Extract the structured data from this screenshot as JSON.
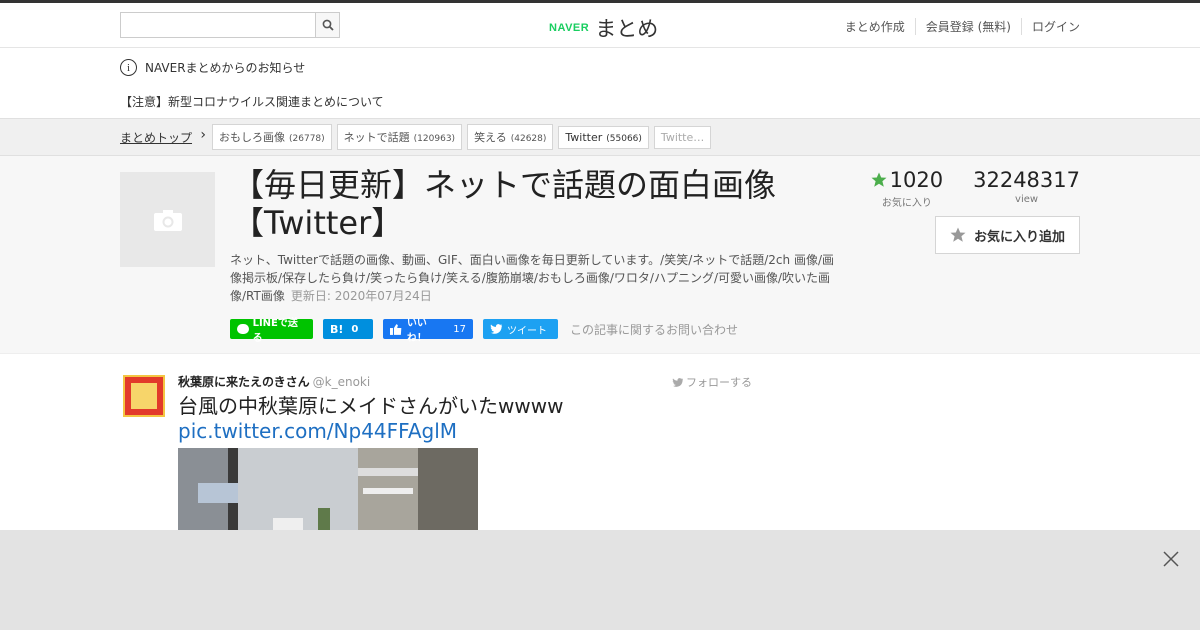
{
  "header": {
    "search_placeholder": "",
    "logo_brand": "NAVER",
    "logo_text": "まとめ",
    "links": [
      "まとめ作成",
      "会員登録 (無料)",
      "ログイン"
    ]
  },
  "notice": {
    "title": "NAVERまとめからのお知らせ",
    "item": "【注意】新型コロナウイルス関連まとめについて"
  },
  "breadcrumb": {
    "top": "まとめトップ",
    "tags": [
      {
        "label": "おもしろ画像",
        "count": "(26778)"
      },
      {
        "label": "ネットで話題",
        "count": "(120963)"
      },
      {
        "label": "笑える",
        "count": "(42628)"
      },
      {
        "label": "Twitter",
        "count": "(55066)"
      },
      {
        "label": "Twitte…",
        "count": ""
      }
    ]
  },
  "article": {
    "title": "【毎日更新】ネットで話題の面白画像【Twitter】",
    "description": "ネット、Twitterで話題の画像、動画、GIF、面白い画像を毎日更新しています。/笑笑/ネットで話題/2ch 画像/画像掲示板/保存したら負け/笑ったら負け/笑える/腹筋崩壊/おもしろ画像/ワロタ/ハプニング/可愛い画像/吹いた画像/RT画像",
    "updated": "更新日: 2020年07月24日",
    "favorites": "1020",
    "favorites_label": "お気に入り",
    "views": "32248317",
    "views_label": "view",
    "fav_button": "お気に入り追加",
    "share": {
      "line": "LINEで送る",
      "hatena_count": "0",
      "fb_label": "いいね！",
      "fb_count": "17",
      "tweet": "ツイート",
      "contact": "この記事に関するお問い合わせ"
    }
  },
  "tweet": {
    "name": "秋葉原に来たえのきさん",
    "handle": "@k_enoki",
    "follow": "フォローする",
    "text": "台風の中秋葉原にメイドさんがいたwwww",
    "link": "pic.twitter.com/Np44FFAglM"
  },
  "colors": {
    "accent_green": "#19ce60",
    "star_green": "#4cae4c",
    "link_blue": "#1e6fc2"
  }
}
